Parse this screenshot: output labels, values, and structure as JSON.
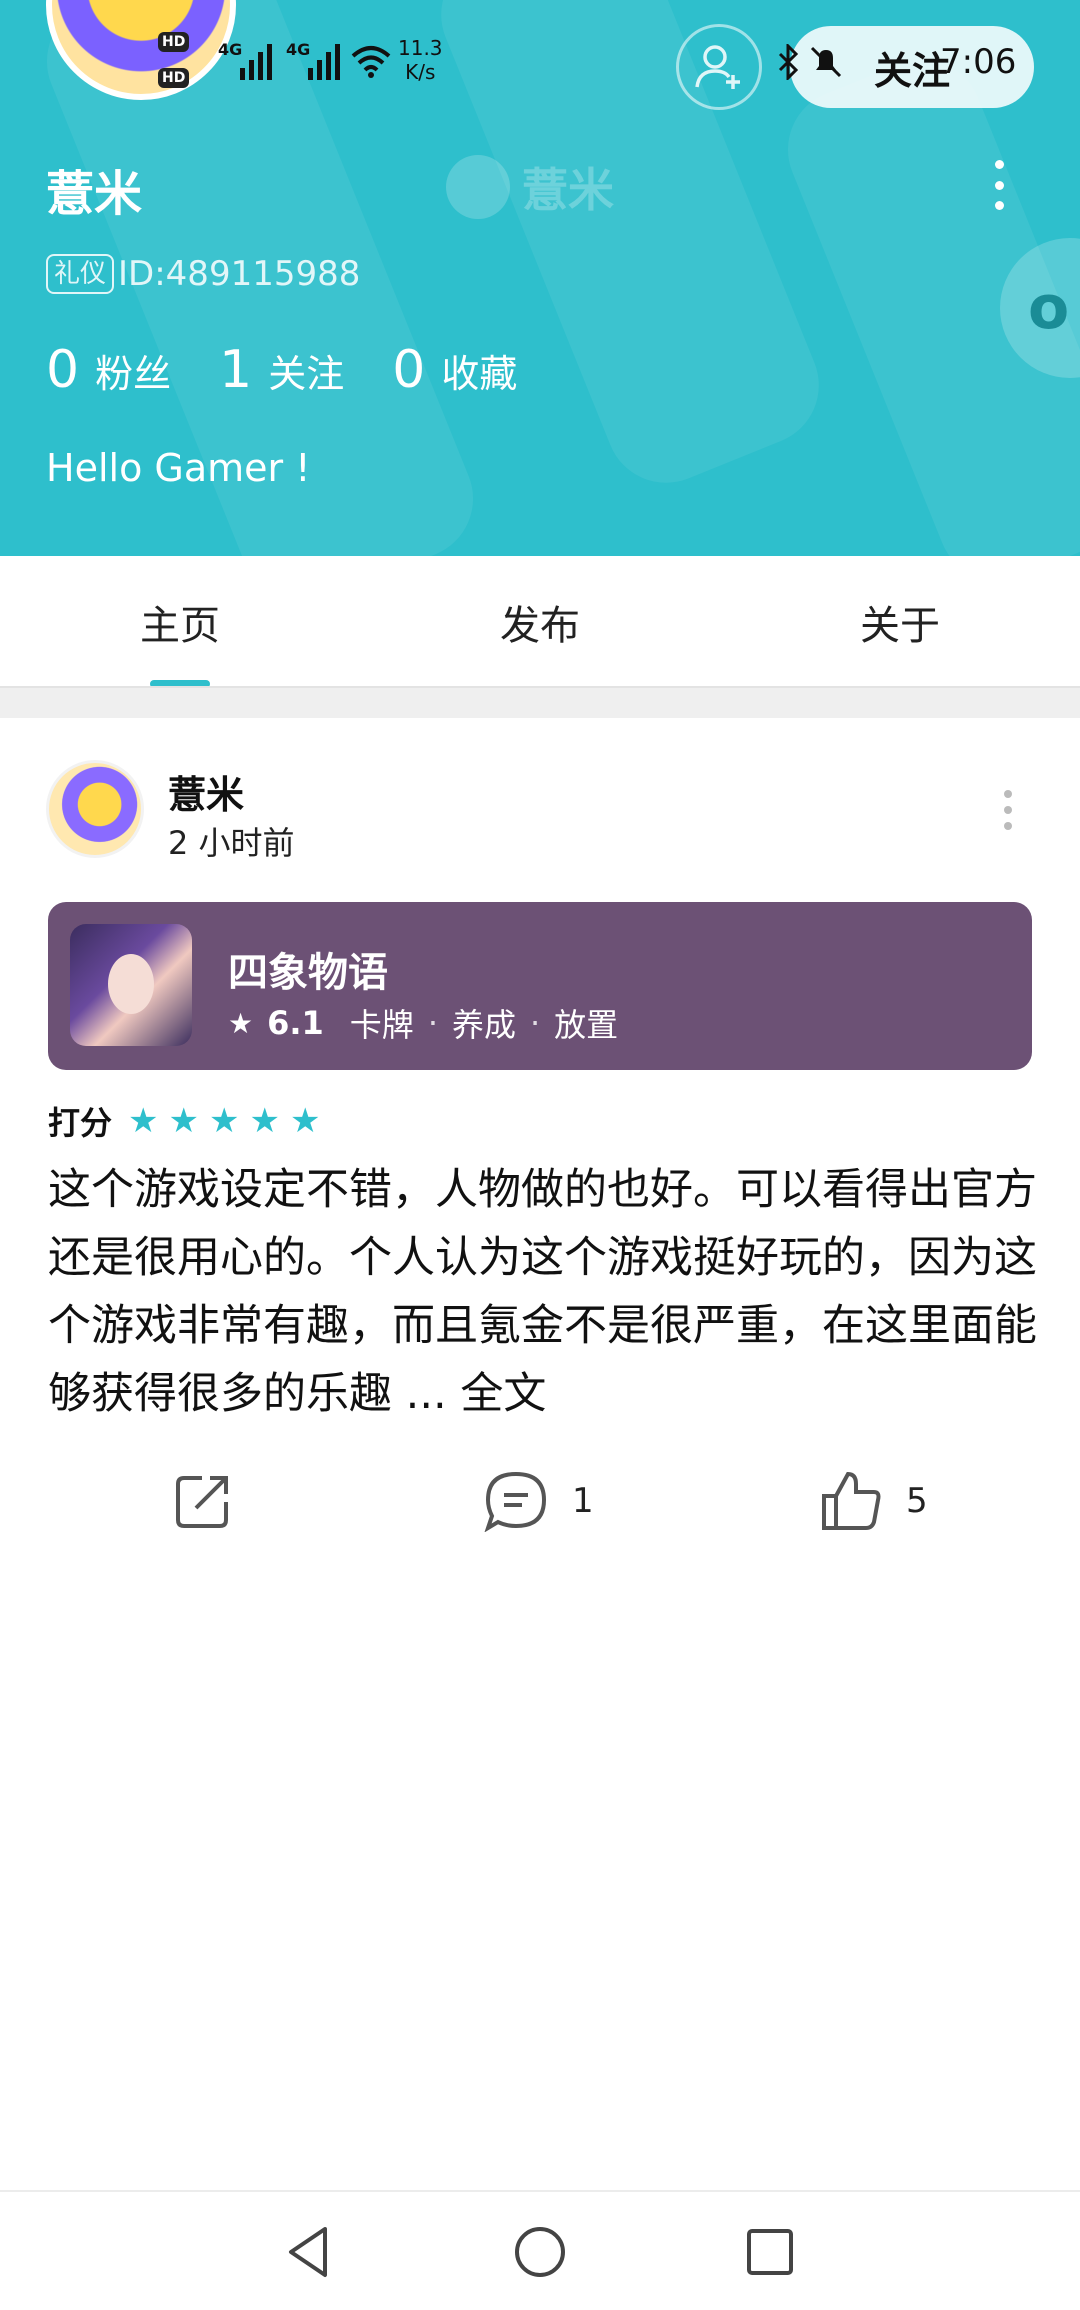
{
  "status_bar": {
    "hd1": "HD",
    "hd2": "HD",
    "net1": "4G",
    "net2": "4G",
    "speed_value": "11.3",
    "speed_unit": "K/s",
    "time": "7:06"
  },
  "profile": {
    "name": "薏米",
    "follow_label": "关注",
    "id_tag": "礼仪",
    "id_text": "ID:489115988",
    "stats": [
      {
        "num": "0",
        "label": "粉丝"
      },
      {
        "num": "1",
        "label": "关注"
      },
      {
        "num": "0",
        "label": "收藏"
      }
    ],
    "bio": "Hello Gamer !"
  },
  "tabs": [
    {
      "label": "主页",
      "active": true
    },
    {
      "label": "发布",
      "active": false
    },
    {
      "label": "关于",
      "active": false
    }
  ],
  "post": {
    "author": "薏米",
    "time": "2 小时前",
    "game": {
      "title": "四象物语",
      "score": "6.1",
      "tags": [
        "卡牌",
        "养成",
        "放置"
      ],
      "tag_separator": "·"
    },
    "rating_label": "打分",
    "rating_stars": 5,
    "review_text": "这个游戏设定不错，人物做的也好。可以看得出官方还是很用心的。个人认为这个游戏挺好玩的，因为这个游戏非常有趣，而且氪金不是很严重，在这里面能够获得很多的乐趣 ...",
    "read_more": "全文",
    "comment_count": "1",
    "like_count": "5"
  },
  "colors": {
    "accent": "#2ebfcc",
    "game_card": "#6c5175"
  }
}
